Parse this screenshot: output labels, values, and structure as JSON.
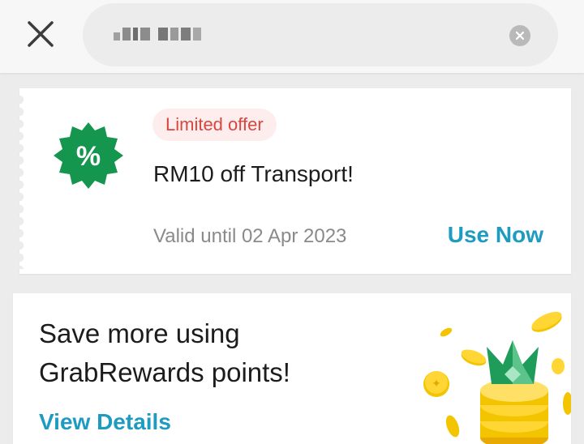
{
  "header": {
    "search_value": "▪▪▪ ▪▪▪▪",
    "close_icon": "close-icon",
    "clear_icon": "clear-icon"
  },
  "offer": {
    "tag": "Limited offer",
    "title": "RM10 off Transport!",
    "validity": "Valid until 02 Apr 2023",
    "action": "Use Now",
    "icon": "percent-badge-icon",
    "colors": {
      "badge": "#14964f",
      "tag_bg": "#fdeeed",
      "tag_text": "#d9463f",
      "action": "#1d9bc0"
    }
  },
  "rewards": {
    "title": "Save more using GrabRewards points!",
    "action": "View Details",
    "illustration": "coins-crown-illustration"
  }
}
